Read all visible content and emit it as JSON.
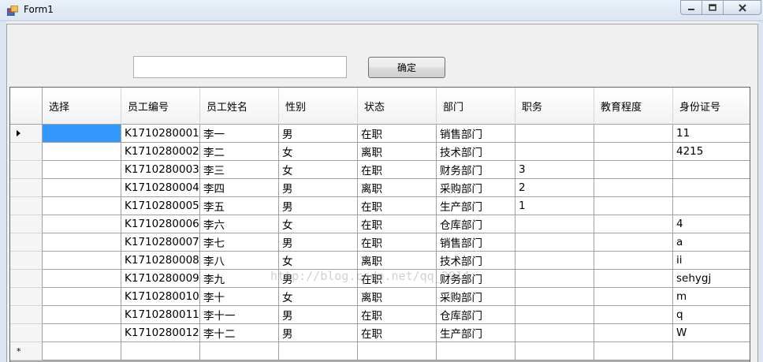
{
  "window": {
    "title": "Form1"
  },
  "toolbar": {
    "input_value": "",
    "confirm_label": "确定"
  },
  "grid": {
    "columns": [
      "选择",
      "员工编号",
      "员工姓名",
      "性别",
      "状态",
      "部门",
      "职务",
      "教育程度",
      "身份证号"
    ],
    "rows": [
      [
        "",
        "K1710280001",
        "李一",
        "男",
        "在职",
        "销售部门",
        "",
        "",
        "11"
      ],
      [
        "",
        "K1710280002",
        "李二",
        "女",
        "离职",
        "技术部门",
        "",
        "",
        "4215"
      ],
      [
        "",
        "K1710280003",
        "李三",
        "女",
        "在职",
        "财务部门",
        "3",
        "",
        ""
      ],
      [
        "",
        "K1710280004",
        "李四",
        "男",
        "离职",
        "采购部门",
        "2",
        "",
        ""
      ],
      [
        "",
        "K1710280005",
        "李五",
        "男",
        "在职",
        "生产部门",
        "1",
        "",
        ""
      ],
      [
        "",
        "K1710280006",
        "李六",
        "女",
        "在职",
        "仓库部门",
        "",
        "",
        "4"
      ],
      [
        "",
        "K1710280007",
        "李七",
        "男",
        "在职",
        "销售部门",
        "",
        "",
        "a"
      ],
      [
        "",
        "K1710280008",
        "李八",
        "女",
        "离职",
        "技术部门",
        "",
        "",
        "ii"
      ],
      [
        "",
        "K1710280009",
        "李九",
        "男",
        "在职",
        "财务部门",
        "",
        "",
        "sehygj"
      ],
      [
        "",
        "K1710280010",
        "李十",
        "女",
        "离职",
        "采购部门",
        "",
        "",
        "m"
      ],
      [
        "",
        "K1710280011",
        "李十一",
        "男",
        "在职",
        "仓库部门",
        "",
        "",
        "q"
      ],
      [
        "",
        "K1710280012",
        "李十二",
        "男",
        "在职",
        "生产部门",
        "",
        "",
        "W"
      ]
    ],
    "new_row_marker": "*"
  },
  "watermark": "http://blog.csdn.net/qq_2014",
  "colors": {
    "selection": "#3399ff",
    "grid_background": "#ababab"
  }
}
